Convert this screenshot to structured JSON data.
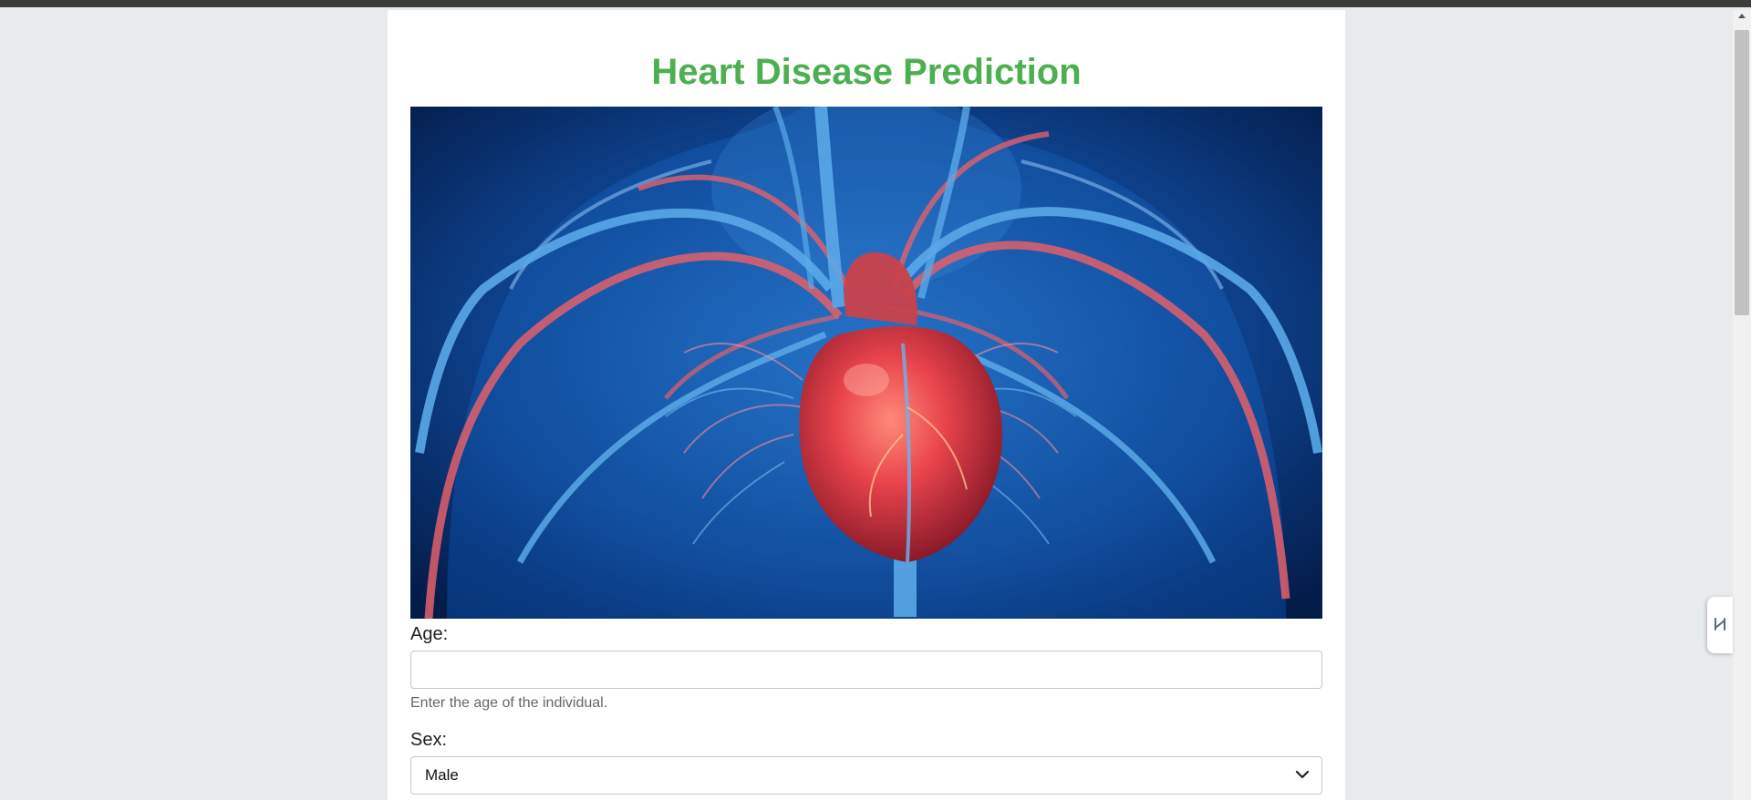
{
  "page": {
    "title": "Heart Disease Prediction",
    "title_color": "#4caf50"
  },
  "hero_image": {
    "description_icon": "heart-anatomy-illustration"
  },
  "form": {
    "age": {
      "label": "Age:",
      "value": "",
      "placeholder": "",
      "help": "Enter the age of the individual."
    },
    "sex": {
      "label": "Sex:",
      "selected": "Male"
    }
  },
  "icons": {
    "side_tab": "extension-panel-icon",
    "scroll_up": "scroll-up-arrow-icon",
    "select": "chevron-down-icon"
  }
}
